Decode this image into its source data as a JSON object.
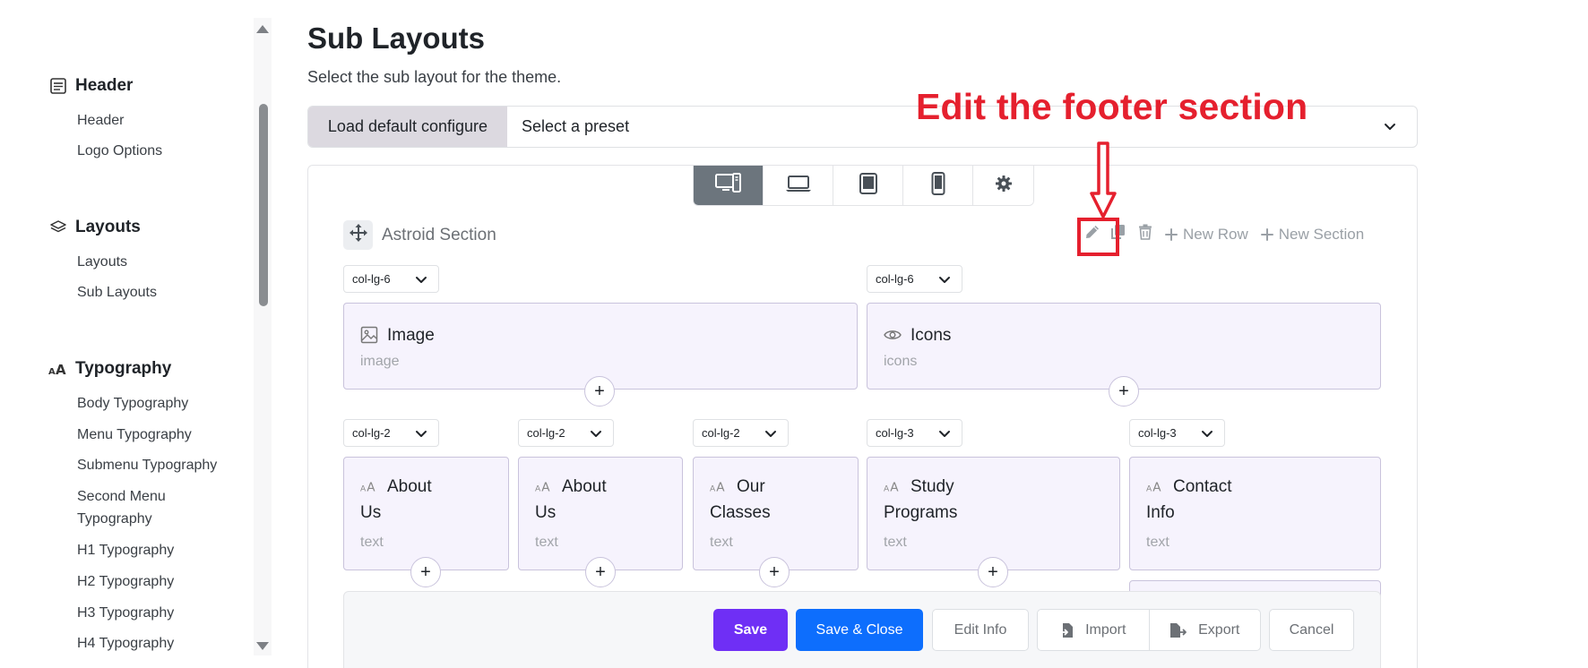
{
  "sidebar": {
    "groups": [
      {
        "title": "Header",
        "icon": "header-icon",
        "items": [
          "Header",
          "Logo Options"
        ]
      },
      {
        "title": "Layouts",
        "icon": "layers-icon",
        "items": [
          "Layouts",
          "Sub Layouts"
        ]
      },
      {
        "title": "Typography",
        "icon": "typography-icon",
        "items": [
          "Body Typography",
          "Menu Typography",
          "Submenu Typography",
          "Second Menu",
          "Typography",
          "H1 Typography",
          "H2 Typography",
          "H3 Typography",
          "H4 Typography"
        ]
      }
    ]
  },
  "page": {
    "title": "Sub Layouts",
    "subtitle": "Select the sub layout for the theme."
  },
  "annotation": "Edit the footer section",
  "preset": {
    "button_label": "Load default configure",
    "select_value": "Select a preset"
  },
  "devices": [
    "desktop-icon",
    "laptop-icon",
    "tablet-icon",
    "mobile-icon",
    "settings-icon"
  ],
  "section": {
    "name": "Astroid Section",
    "tools": {
      "new_row": "New Row",
      "new_section": "New Section"
    }
  },
  "rows": [
    {
      "columns": [
        {
          "size": "col-lg-6",
          "title": "Image",
          "sub": "image",
          "icon": "image-icon"
        },
        {
          "size": "col-lg-6",
          "title": "Icons",
          "sub": "icons",
          "icon": "eye-icon"
        }
      ]
    },
    {
      "columns": [
        {
          "size": "col-lg-2",
          "title_line1": "About",
          "title_line2": "Us",
          "sub": "text",
          "icon": "text-icon"
        },
        {
          "size": "col-lg-2",
          "title_line1": "About",
          "title_line2": "Us",
          "sub": "text",
          "icon": "text-icon"
        },
        {
          "size": "col-lg-2",
          "title_line1": "Our",
          "title_line2": "Classes",
          "sub": "text",
          "icon": "text-icon"
        },
        {
          "size": "col-lg-3",
          "title_line1": "Study",
          "title_line2": "Programs",
          "sub": "text",
          "icon": "text-icon"
        },
        {
          "size": "col-lg-3",
          "title_line1": "Contact",
          "title_line2": "Info",
          "sub": "text",
          "icon": "text-icon"
        }
      ]
    }
  ],
  "add_symbol": "+",
  "actions": {
    "save": "Save",
    "save_close": "Save & Close",
    "edit_info": "Edit Info",
    "import": "Import",
    "export": "Export",
    "cancel": "Cancel"
  },
  "colors": {
    "accent_purple": "#6f2ff5",
    "accent_blue": "#0d6efd",
    "annotation_red": "#e5202e",
    "block_bg": "#f6f3fd"
  }
}
